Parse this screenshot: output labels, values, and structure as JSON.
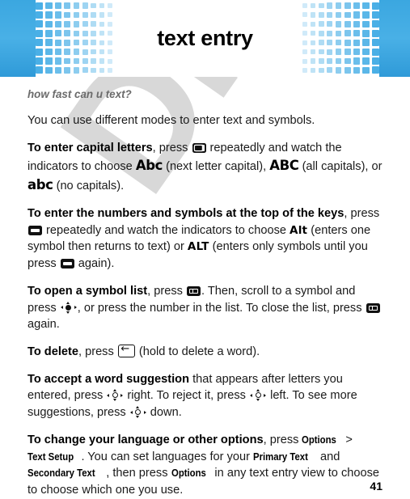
{
  "document": {
    "page_number": "41",
    "watermark_text": "DRAFT"
  },
  "header": {
    "title": "text entry",
    "accent_color": "#4aafe6",
    "band_color": "#3ba7e0",
    "pattern": "fading-square-grid"
  },
  "body": {
    "subtitle": "how fast can u text?",
    "intro": "You can use different modes to enter text and symbols.",
    "sections": [
      {
        "lead": "To enter capital letters",
        "t1": ", press ",
        "icon1": "shift-key-icon",
        "t2": " repeatedly and watch the indicators to choose ",
        "ind1": "Abc",
        "t3": " (next letter capital), ",
        "ind2": "ABC",
        "t4": " (all capitals), or ",
        "ind3": "abc",
        "t5": " (no capitals)."
      },
      {
        "lead": "To enter the numbers and symbols at the top of the keys",
        "t1": ", press ",
        "icon1": "alt-key-icon",
        "t2": " repeatedly and watch the indicators to choose ",
        "ind1": "Alt",
        "t3": " (enters one symbol then returns to text) or ",
        "ind2": "ALT",
        "t4": " (enters only symbols until you press ",
        "icon2": "alt-key-icon",
        "t5": " again)."
      },
      {
        "lead": "To open a symbol list",
        "t1": ", press ",
        "icon1": "symbol-key-icon",
        "t2": ". Then, scroll to a symbol and press ",
        "icon2": "nav-center-select-icon",
        "t3": ", or press the number in the list. To close the list, press ",
        "icon3": "symbol-key-icon",
        "t4": " again."
      },
      {
        "lead": "To delete",
        "t1": ", press ",
        "icon1": "delete-key-icon",
        "t2": " (hold to delete a word)."
      },
      {
        "lead": "To accept a word suggestion",
        "t1": " that appears after letters you entered, press ",
        "icon1": "nav-key-icon",
        "t2": " right. To reject it, press ",
        "icon2": "nav-key-icon",
        "t3": " left. To see more suggestions, press ",
        "icon3": "nav-key-icon",
        "t4": " down."
      },
      {
        "lead": "To change your language or other options",
        "t1": ", press ",
        "menu1": "Options",
        "t2": " > ",
        "menu2": "Text Setup",
        "t3": ". You can set languages for your ",
        "menu3": "Primary Text",
        "t4": " and ",
        "menu4": "Secondary Text",
        "t5": ", then press ",
        "menu5": "Options",
        "t6": " in any text entry view to choose to choose which one you use."
      }
    ]
  }
}
